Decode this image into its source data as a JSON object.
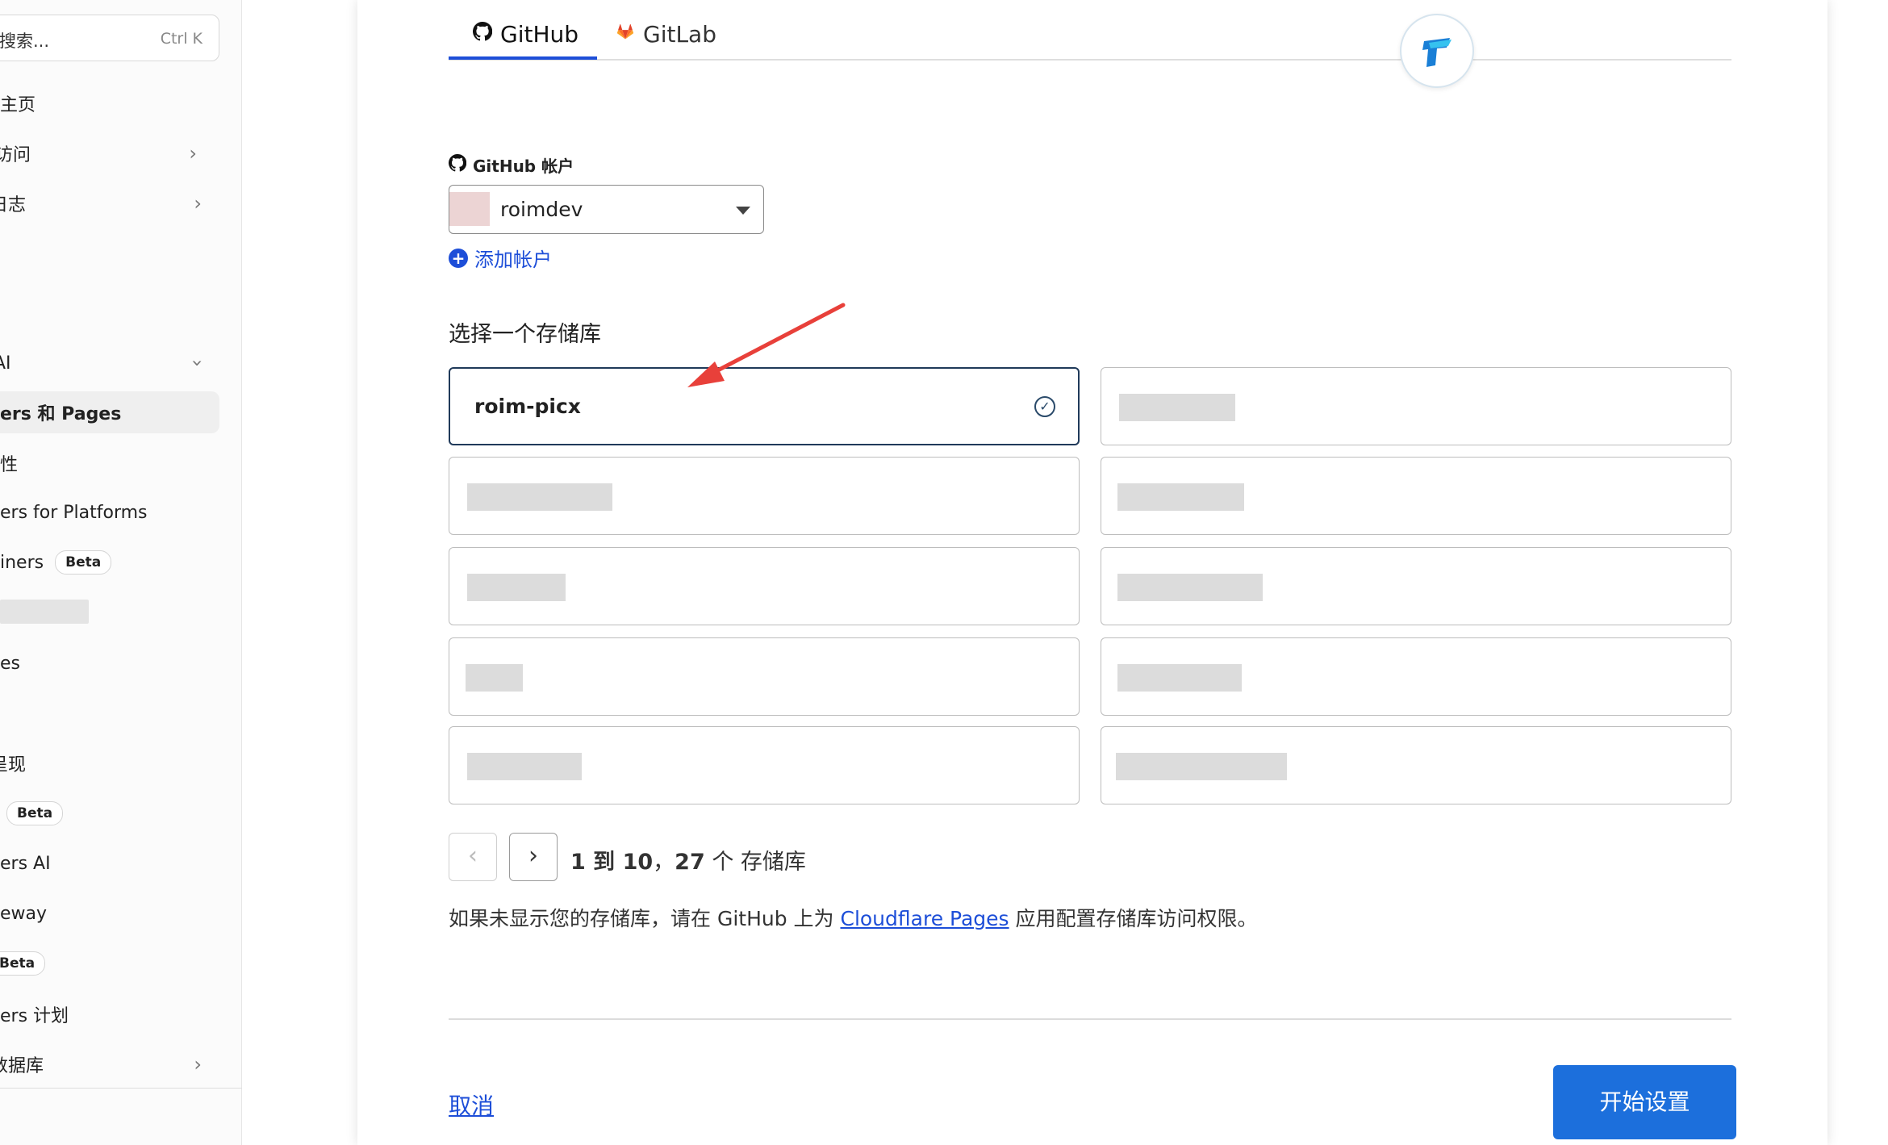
{
  "sidebar": {
    "search_placeholder": "搜索...",
    "search_shortcut": "Ctrl K",
    "items": [
      {
        "label": "主页"
      },
      {
        "label": "访问"
      },
      {
        "label": "日志"
      },
      {
        "label": "AI"
      },
      {
        "label": "ers 和 Pages"
      },
      {
        "label": "性"
      },
      {
        "label": "ers for Platforms"
      },
      {
        "label": "iners",
        "badge": "Beta"
      },
      {
        "label": "es"
      },
      {
        "label": "呈现"
      },
      {
        "label": "",
        "badge": "Beta"
      },
      {
        "label": "ers AI"
      },
      {
        "label": "eway"
      },
      {
        "label": "",
        "badge": "Beta"
      },
      {
        "label": "ers 计划"
      },
      {
        "label": "数据库"
      }
    ]
  },
  "tabs": [
    {
      "label": "GitHub"
    },
    {
      "label": "GitLab"
    }
  ],
  "account": {
    "label": "GitHub 帐户",
    "selected": "roimdev",
    "add_label": "添加帐户"
  },
  "repos": {
    "heading": "选择一个存储库",
    "selected_name": "roim-picx"
  },
  "pager": {
    "prev": "‹",
    "next": "›",
    "range": "1 到 10",
    "sep": "，",
    "total": "27",
    "suffix": " 个 存储库"
  },
  "help": {
    "prefix": "如果未显示您的存储库，请在 GitHub 上为 ",
    "link": "Cloudflare Pages",
    "suffix": " 应用配置存储库访问权限。"
  },
  "footer": {
    "cancel": "取消",
    "start": "开始设置"
  },
  "colors": {
    "accent": "#1d4ed8",
    "primary_button": "#1c6fdc",
    "annotation_arrow": "#e8403a"
  }
}
